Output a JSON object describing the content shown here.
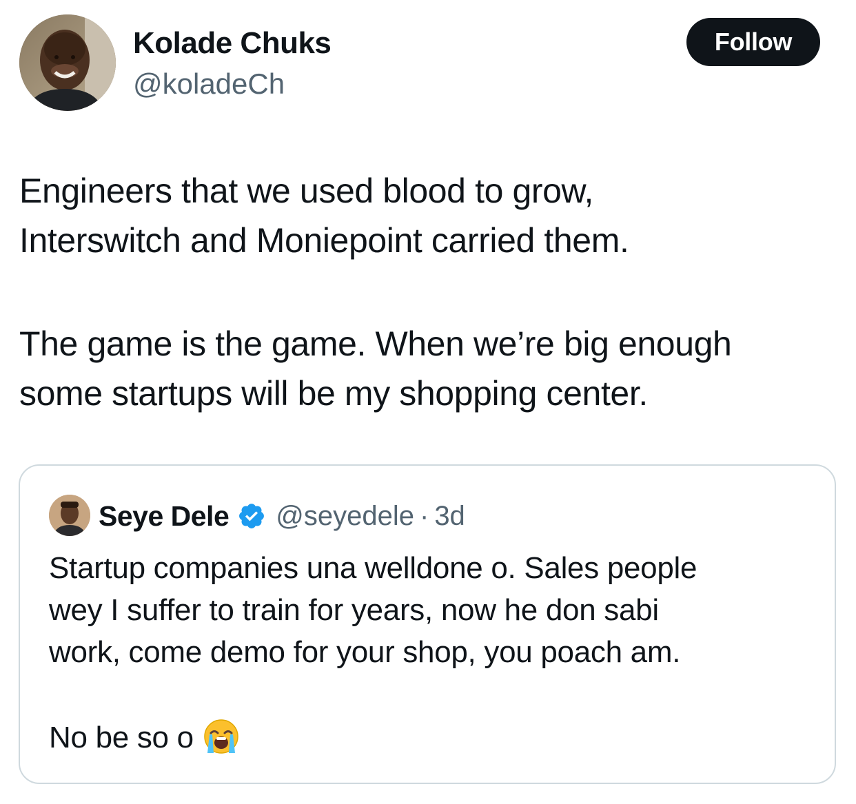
{
  "author": {
    "name": "Kolade Chuks",
    "handle": "@koladeCh",
    "avatar_icon": "profile-photo"
  },
  "follow_button": {
    "label": "Follow",
    "bg_color": "#0f1419"
  },
  "tweet": {
    "paragraph1_line1": "Engineers that we used blood to grow,",
    "paragraph1_line2": "Interswitch and Moniepoint carried them.",
    "paragraph2_line1": "The game is the game. When we’re big enough",
    "paragraph2_line2": "some startups will be my shopping center."
  },
  "quoted_tweet": {
    "name": "Seye Dele",
    "verified_icon": "verified-badge-icon",
    "verified_color": "#1d9bf0",
    "handle": "@seyedele",
    "separator": "·",
    "time": "3d",
    "line1": "Startup companies una welldone o. Sales people",
    "line2": "wey I suffer to train for years, now he don sabi",
    "line3": "work, come demo for your shop, you poach am.",
    "line4": "No be so o",
    "emoji_icon": "loudly-crying-face-emoji"
  },
  "colors": {
    "text_primary": "#0f1419",
    "text_secondary": "#536471",
    "border": "#cfd9de"
  }
}
